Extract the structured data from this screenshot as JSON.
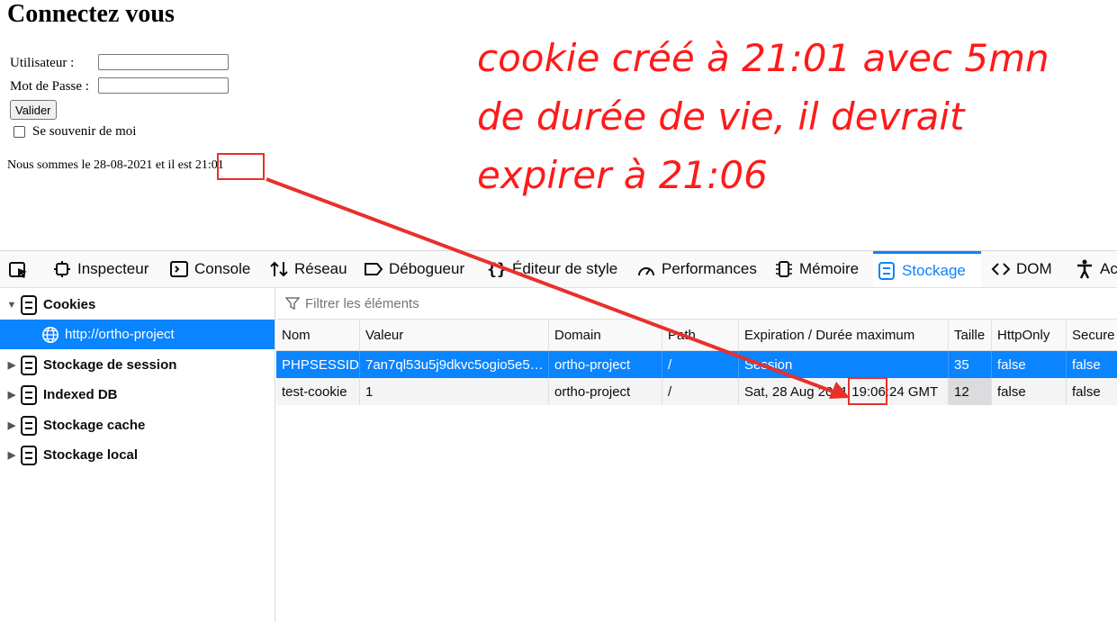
{
  "login": {
    "title": "Connectez vous",
    "user_label": "Utilisateur :",
    "password_label": "Mot de Passe :",
    "user_value": "",
    "password_value": "",
    "submit_label": "Valider",
    "remember_label": "Se souvenir de moi",
    "date_text": "Nous sommes le 28-08-2021 et il est ",
    "time_text": "21:01"
  },
  "annotation": {
    "text": "cookie créé à 21:01 avec 5mn de durée de vie, il devrait expirer à 21:06",
    "color": "#ff1a1a"
  },
  "devtools": {
    "tabs": [
      {
        "label": "Inspecteur",
        "icon": "inspector-icon"
      },
      {
        "label": "Console",
        "icon": "console-icon"
      },
      {
        "label": "Réseau",
        "icon": "network-icon"
      },
      {
        "label": "Débogueur",
        "icon": "debugger-icon"
      },
      {
        "label": "Éditeur de style",
        "icon": "style-editor-icon"
      },
      {
        "label": "Performances",
        "icon": "performance-icon"
      },
      {
        "label": "Mémoire",
        "icon": "memory-icon"
      },
      {
        "label": "Stockage",
        "icon": "storage-icon",
        "active": true
      },
      {
        "label": "DOM",
        "icon": "dom-icon"
      },
      {
        "label": "Ac",
        "icon": "accessibility-icon"
      }
    ],
    "sidebar": {
      "cookies_label": "Cookies",
      "cookie_host": "http://ortho-project",
      "items": [
        "Stockage de session",
        "Indexed DB",
        "Stockage cache",
        "Stockage local"
      ]
    },
    "filter_placeholder": "Filtrer les éléments",
    "table": {
      "columns": [
        "Nom",
        "Valeur",
        "Domain",
        "Path",
        "Expiration / Durée maximum",
        "Taille",
        "HttpOnly",
        "Secure"
      ],
      "rows": [
        [
          "PHPSESSID",
          "7an7ql53u5j9dkvc5ogio5e5…",
          "ortho-project",
          "/",
          "Session",
          "35",
          "false",
          "false"
        ],
        [
          "test-cookie",
          "1",
          "ortho-project",
          "/",
          "Sat, 28 Aug 2021 19:06:24 GMT",
          "12",
          "false",
          "false"
        ]
      ]
    },
    "accent_color": "#0a84ff"
  }
}
